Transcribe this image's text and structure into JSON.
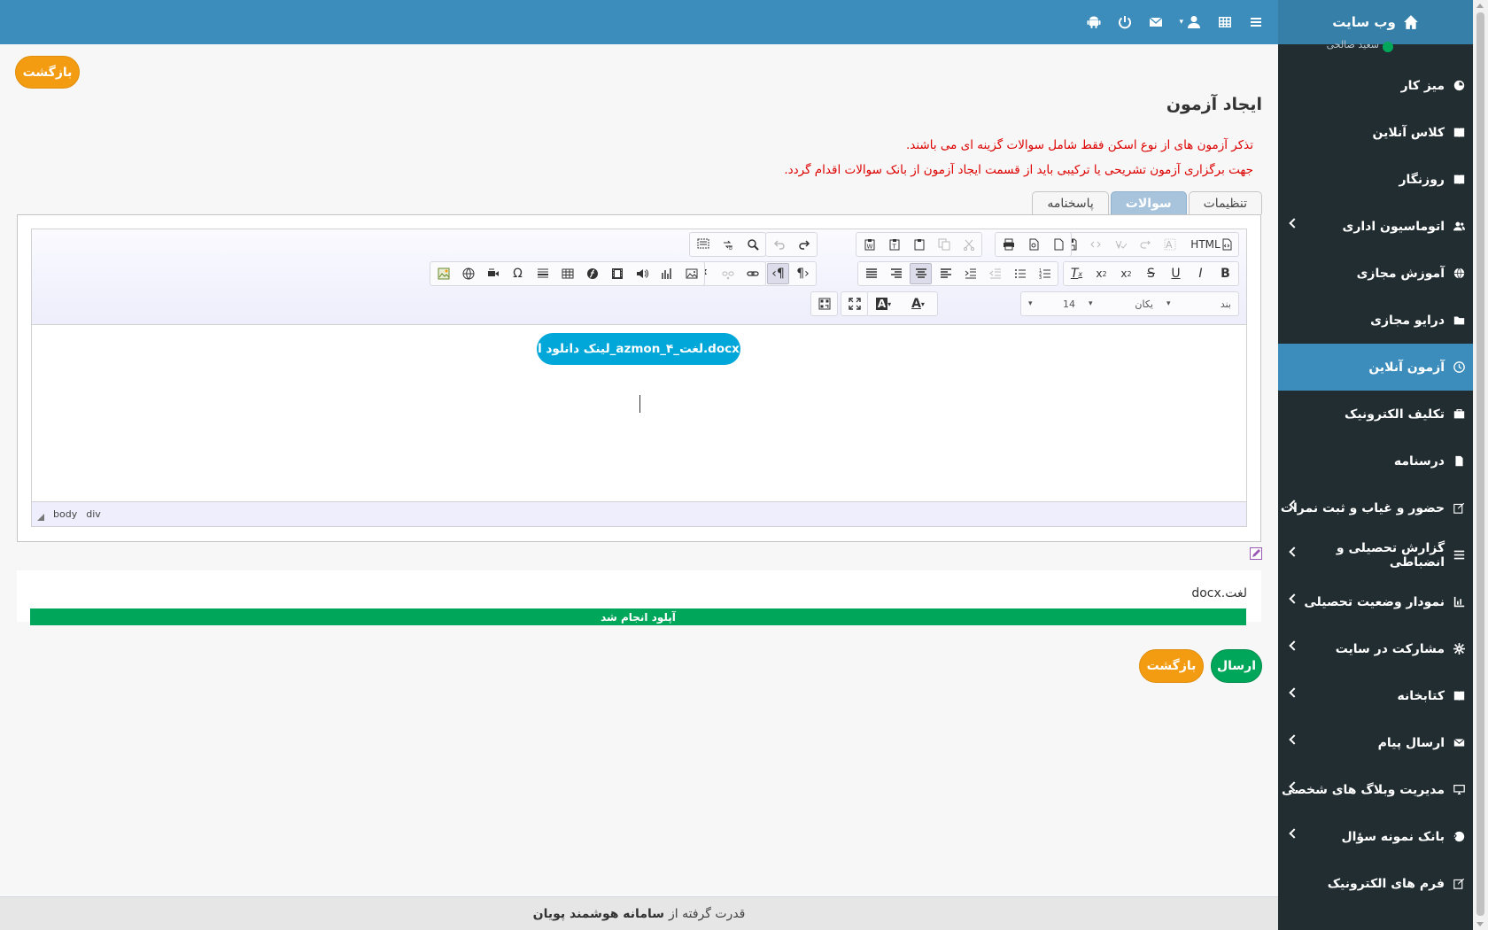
{
  "topbar": {
    "icons": [
      "menu-icon",
      "grid-icon",
      "user-icon",
      "envelope-icon",
      "power-icon",
      "android-icon"
    ]
  },
  "sidebar": {
    "logo": "وب سایت",
    "user": "سعید صالحی",
    "items": [
      {
        "label": "میز کار",
        "icon": "dashboard-icon",
        "chevron": false,
        "active": false
      },
      {
        "label": "کلاس آنلاین",
        "icon": "book-icon",
        "chevron": false,
        "active": false
      },
      {
        "label": "روزنگار",
        "icon": "book-icon",
        "chevron": false,
        "active": false
      },
      {
        "label": "اتوماسیون اداری",
        "icon": "users-icon",
        "chevron": true,
        "active": false
      },
      {
        "label": "آموزش مجازی",
        "icon": "globe-icon",
        "chevron": false,
        "active": false
      },
      {
        "label": "درایو مجازی",
        "icon": "folder-icon",
        "chevron": false,
        "active": false
      },
      {
        "label": "آزمون آنلاین",
        "icon": "clock-icon",
        "chevron": false,
        "active": true
      },
      {
        "label": "تکلیف الکترونیک",
        "icon": "briefcase-icon",
        "chevron": false,
        "active": false
      },
      {
        "label": "درسنامه",
        "icon": "file-icon",
        "chevron": false,
        "active": false
      },
      {
        "label": "حضور و غیاب و ثبت نمرات",
        "icon": "edit-icon",
        "chevron": true,
        "active": false
      },
      {
        "label": "گزارش تحصیلی و انضباطی",
        "icon": "list-icon",
        "chevron": true,
        "active": false
      },
      {
        "label": "نمودار وضعیت تحصیلی",
        "icon": "bar-chart-icon",
        "chevron": true,
        "active": false
      },
      {
        "label": "مشارکت در سایت",
        "icon": "cog-icon",
        "chevron": true,
        "active": false
      },
      {
        "label": "کتابخانه",
        "icon": "book-icon",
        "chevron": true,
        "active": false
      },
      {
        "label": "ارسال پیام",
        "icon": "envelope-icon",
        "chevron": true,
        "active": false
      },
      {
        "label": "مدیریت وبلاگ های شخصی",
        "icon": "monitor-icon",
        "chevron": true,
        "active": false
      },
      {
        "label": "بانک نمونه سؤال",
        "icon": "question-icon",
        "chevron": true,
        "active": false
      },
      {
        "label": "فرم های الکترونیک",
        "icon": "edit-icon",
        "chevron": false,
        "active": false
      }
    ]
  },
  "main": {
    "back_label": "بازگشت",
    "title": "ایجاد آزمون",
    "warning1": "تذکر آزمون های از نوع اسکن فقط شامل سوالات گزینه ای می باشند.",
    "warning2": "جهت برگزاری آزمون تشریحی یا ترکیبی باید از قسمت ایجاد آزمون از بانک سوالات اقدام گردد.",
    "tabs": [
      "تنظیمات",
      "سوالات",
      "پاسخنامه"
    ],
    "active_tab": "سوالات",
    "editor": {
      "html_label": "HTML",
      "format_select": "بند",
      "font_select": "یکان",
      "size_select": "14",
      "download_link": "لینک دانلود ا_azmon_۴_لغت.docx",
      "path": [
        "body",
        "div"
      ]
    },
    "upload": {
      "file_name": "لغت.docx",
      "status": "آپلود انجام شد"
    },
    "submit_label": "ارسال",
    "back2_label": "بازگشت"
  },
  "footer": {
    "prefix": "قدرت گرفته از",
    "brand": "سامانه هوشمند پویان"
  },
  "colors": {
    "topbar": "#3c8dbc",
    "sidebar": "#222d32",
    "active_item": "#3c8dbc",
    "orange": "#f39c12",
    "green": "#00a65a",
    "warning": "#dd0000",
    "link": "#00a7d8"
  }
}
